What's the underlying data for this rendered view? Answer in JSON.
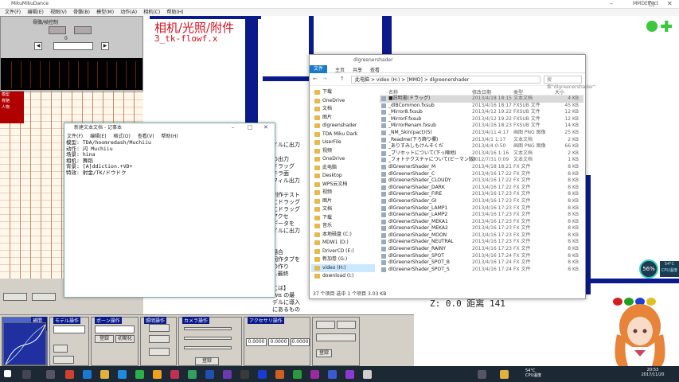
{
  "mmd": {
    "title": "MikuMikuDance",
    "right_label": "MMDEffect",
    "menu": [
      "文件(F)",
      "编辑(E)",
      "视图(V)",
      "骨骼(B)",
      "模型(M)",
      "动作(A)",
      "相机(C)",
      "帮助(H)"
    ],
    "left_panel": {
      "title": "骨骼/帧控制",
      "frame_label": "0",
      "names": [
        "模型",
        "骨骼",
        "人物"
      ]
    },
    "viewport": {
      "title_line1": "相机/光照/附件",
      "title_line2": "3_tk-flowf.x",
      "coords": "Z: 0.0  距离 141",
      "side_text": "イルに出力\n\nの出力\nドラッグ\nテラ面\nフィル出力\n\n制作テスト\nにドラッグ\nにドラッグ\nアクセ\nデータを\nイルに出力\n\n\n場合\n同作タブを\nの作り\n...最終\n\nには】\nsvn の最\nデルに導入\nにあるもの"
    },
    "bottom": {
      "interp_label": "補間曲線",
      "model_label": "モデル操作",
      "bone_label": "ボーン操作",
      "light_label": "照明操作",
      "camera_label": "カメラ操作",
      "accessory_label": "アクセサリ操作",
      "register": "登録",
      "reset": "初期化",
      "values": [
        "0.0000",
        "0.0000",
        "0.0000"
      ]
    }
  },
  "notepad": {
    "title": "新建文本文档 - 记事本",
    "menu": [
      "文件(F)",
      "编辑(E)",
      "格式(O)",
      "查看(V)",
      "帮助(H)"
    ],
    "body": "模型: TDA/hoomredash/Muchiiu\n动作: 闪 Muchiiu\n场景: hina\n相机: 舞蹈\n背景: [A]ddiction.+VD+\n特效: 射金/TK/ドウドク"
  },
  "explorer": {
    "title": "dlgreenershader",
    "ribbon": [
      "文件",
      "主页",
      "共享",
      "查看"
    ],
    "path": "此电脑 > video (H:) > [MMD] > dlgreenershader",
    "search_placeholder": "搜索\"dlgreenershader\"",
    "columns": [
      "名称",
      "修改日期",
      "类型",
      "大小"
    ],
    "nav": [
      {
        "label": "下载",
        "selected": false
      },
      {
        "label": "OneDrive",
        "selected": false
      },
      {
        "label": "文档",
        "selected": false
      },
      {
        "label": "图片",
        "selected": false
      },
      {
        "label": "dlgreenshader",
        "selected": false
      },
      {
        "label": "TDA Miku Dark",
        "selected": false
      },
      {
        "label": "UserFile",
        "selected": false
      },
      {
        "label": "视频",
        "selected": false
      },
      {
        "label": "OneDrive",
        "selected": false
      },
      {
        "label": "此电脑",
        "selected": false
      },
      {
        "label": "Desktop",
        "selected": false
      },
      {
        "label": "WPS云文档",
        "selected": false
      },
      {
        "label": "视频",
        "selected": false
      },
      {
        "label": "图片",
        "selected": false
      },
      {
        "label": "文档",
        "selected": false
      },
      {
        "label": "下载",
        "selected": false
      },
      {
        "label": "音乐",
        "selected": false
      },
      {
        "label": "本地磁盘 (C:)",
        "selected": false
      },
      {
        "label": "MDW1 (D:)",
        "selected": false
      },
      {
        "label": "DriverCD (E:)",
        "selected": false
      },
      {
        "label": "新加卷 (G:)",
        "selected": false
      },
      {
        "label": "video (H:)",
        "selected": true
      },
      {
        "label": "download (I:)",
        "selected": false
      }
    ],
    "files": [
      {
        "name": "■説明書(ドラッグ)",
        "date": "2013/4/18 18:15",
        "type": "文本文档",
        "size": "4 KB",
        "sel": true
      },
      {
        "name": "_dlBCommon.fxsub",
        "date": "2013/4/16 18:17",
        "type": "FXSUB 文件",
        "size": "45 KB"
      },
      {
        "name": "_Mirror8.fxsub",
        "date": "2013/4/12 19:22",
        "type": "FXSUB 文件",
        "size": "12 KB"
      },
      {
        "name": "_MirrorF.fxsub",
        "date": "2013/4/12 19:22",
        "type": "FXSUB 文件",
        "size": "12 KB"
      },
      {
        "name": "_MirrorRenam.fxsub",
        "date": "2013/4/16 18:23",
        "type": "FXSUB 文件",
        "size": "14 KB"
      },
      {
        "name": "_NM_Skin(pact)(5)",
        "date": "2013/4/11 4:17",
        "type": "画图 PNG 图像",
        "size": "25 KB"
      },
      {
        "name": "_Readme(下ろ飾り欄)",
        "date": "2013/4/1 1:17",
        "type": "文本文档",
        "size": "2 KB"
      },
      {
        "name": "_ありすみしもけんそくだ",
        "date": "2013/4/4 0:50",
        "type": "画图 PNG 图像",
        "size": "66 KB"
      },
      {
        "name": "_プリセットについて(下っ陣地)",
        "date": "2013/4/16 1:16",
        "type": "文本文档",
        "size": "2 KB"
      },
      {
        "name": "_フォトテクスチャについて(ビーマン版)",
        "date": "2012/7/31 0:09",
        "type": "文本文档",
        "size": "1 KB"
      },
      {
        "name": "dlGreenerShader_M",
        "date": "2013/4/18 18:21",
        "type": "FX 文件",
        "size": "8 KB"
      },
      {
        "name": "dlGreenerShader_C",
        "date": "2013/4/16 17:22",
        "type": "FX 文件",
        "size": "8 KB"
      },
      {
        "name": "dlGreenerShader_CLOUDY",
        "date": "2013/4/16 17:22",
        "type": "FX 文件",
        "size": "8 KB"
      },
      {
        "name": "dlGreenerShader_DARK",
        "date": "2013/4/16 17:22",
        "type": "FX 文件",
        "size": "8 KB"
      },
      {
        "name": "dlGreenerShader_FIRE",
        "date": "2013/4/16 17:23",
        "type": "FX 文件",
        "size": "8 KB"
      },
      {
        "name": "dlGreenerShader_GI",
        "date": "2013/4/16 17:23",
        "type": "FX 文件",
        "size": "8 KB"
      },
      {
        "name": "dlGreenerShader_LAMP1",
        "date": "2013/4/16 17:23",
        "type": "FX 文件",
        "size": "8 KB"
      },
      {
        "name": "dlGreenerShader_LAMP2",
        "date": "2013/4/16 17:23",
        "type": "FX 文件",
        "size": "8 KB"
      },
      {
        "name": "dlGreenerShader_MEKA1",
        "date": "2013/4/16 17:23",
        "type": "FX 文件",
        "size": "8 KB"
      },
      {
        "name": "dlGreenerShader_MEKA2",
        "date": "2013/4/16 17:23",
        "type": "FX 文件",
        "size": "8 KB"
      },
      {
        "name": "dlGreenerShader_MOON",
        "date": "2013/4/16 17:23",
        "type": "FX 文件",
        "size": "8 KB"
      },
      {
        "name": "dlGreenerShader_NEUTRAL",
        "date": "2013/4/16 17:23",
        "type": "FX 文件",
        "size": "8 KB"
      },
      {
        "name": "dlGreenerShader_RAINY",
        "date": "2013/4/16 17:23",
        "type": "FX 文件",
        "size": "8 KB"
      },
      {
        "name": "dlGreenerShader_SPOT",
        "date": "2013/4/16 17:24",
        "type": "FX 文件",
        "size": "8 KB"
      },
      {
        "name": "dlGreenerShader_SPOT_B",
        "date": "2013/4/16 17:24",
        "type": "FX 文件",
        "size": "8 KB"
      },
      {
        "name": "dlGreenerShader_SPOT_S",
        "date": "2013/4/16 17:24",
        "type": "FX 文件",
        "size": "8 KB"
      }
    ],
    "status": "37 个项目    选中 1 个项目  3.03 KB"
  },
  "overlay": {
    "cpu_percent": "56%",
    "cpu_temp": "54°C",
    "cpu_label": "CPU温度"
  },
  "taskbar": {
    "cpu_line1": "54°C",
    "cpu_line2": "CPU温度",
    "time": "20:53",
    "date": "2017/11/20"
  },
  "colors": {
    "accent_red": "#d01020",
    "mmd_blue": "#0a1a8a",
    "explorer_file_tab": "#1979ca",
    "taskbar": "#1c2833"
  }
}
